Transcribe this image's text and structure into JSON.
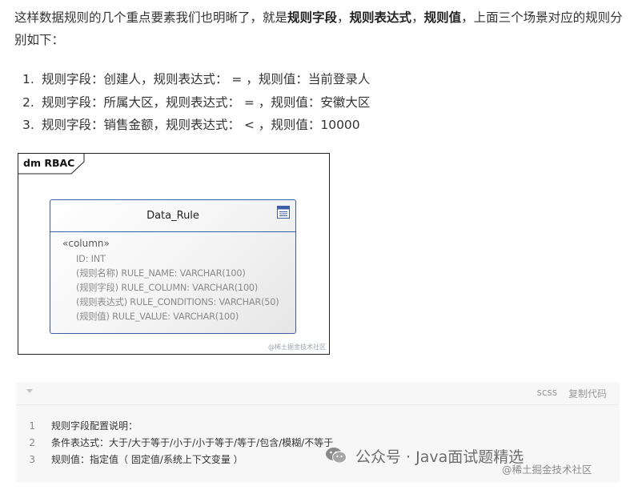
{
  "intro": {
    "text_a": "这样数据规则的几个重点要素我们也明晰了，就是",
    "bold_1": "规则字段",
    "sep_1": "，",
    "bold_2": "规则表达式",
    "sep_2": "，",
    "bold_3": "规则值",
    "text_b": "，上面三个场景对应的规则分别如下："
  },
  "rules": [
    {
      "num": "1.",
      "text": "规则字段：创建人，规则表达式： = ，规则值：当前登录人"
    },
    {
      "num": "2.",
      "text": "规则字段：所属大区，规则表达式： = ，规则值：安徽大区"
    },
    {
      "num": "3.",
      "text": "规则字段：销售金额，规则表达式： < ，规则值：10000"
    }
  ],
  "diagram": {
    "package_label": "dm RBAC",
    "class_name": "Data_Rule",
    "stereotype": "«column»",
    "attributes": [
      "ID: INT",
      "(规则名称) RULE_NAME: VARCHAR(100)",
      "(规则字段) RULE_COLUMN: VARCHAR(100)",
      "(规则表达式) RULE_CONDITIONS: VARCHAR(50)",
      "(规则值) RULE_VALUE: VARCHAR(100)"
    ],
    "watermark": "@稀土掘金技术社区"
  },
  "code": {
    "language": "scss",
    "copy_label": "复制代码",
    "lines": [
      {
        "n": "1",
        "text": "规则字段配置说明："
      },
      {
        "n": "2",
        "text": "条件表达式：大于/大于等于/小于/小于等于/等于/包含/模糊/不等于"
      },
      {
        "n": "3",
        "text": "规则值：指定值（ 固定值/系统上下文变量 ）"
      }
    ]
  },
  "overlay": {
    "account": "公众号 · Java面试题精选",
    "sub": "@稀土掘金技术社区"
  },
  "colors": {
    "class_border": "#3c5ea9",
    "text": "#333333",
    "code_bg": "#f7f7f8"
  }
}
